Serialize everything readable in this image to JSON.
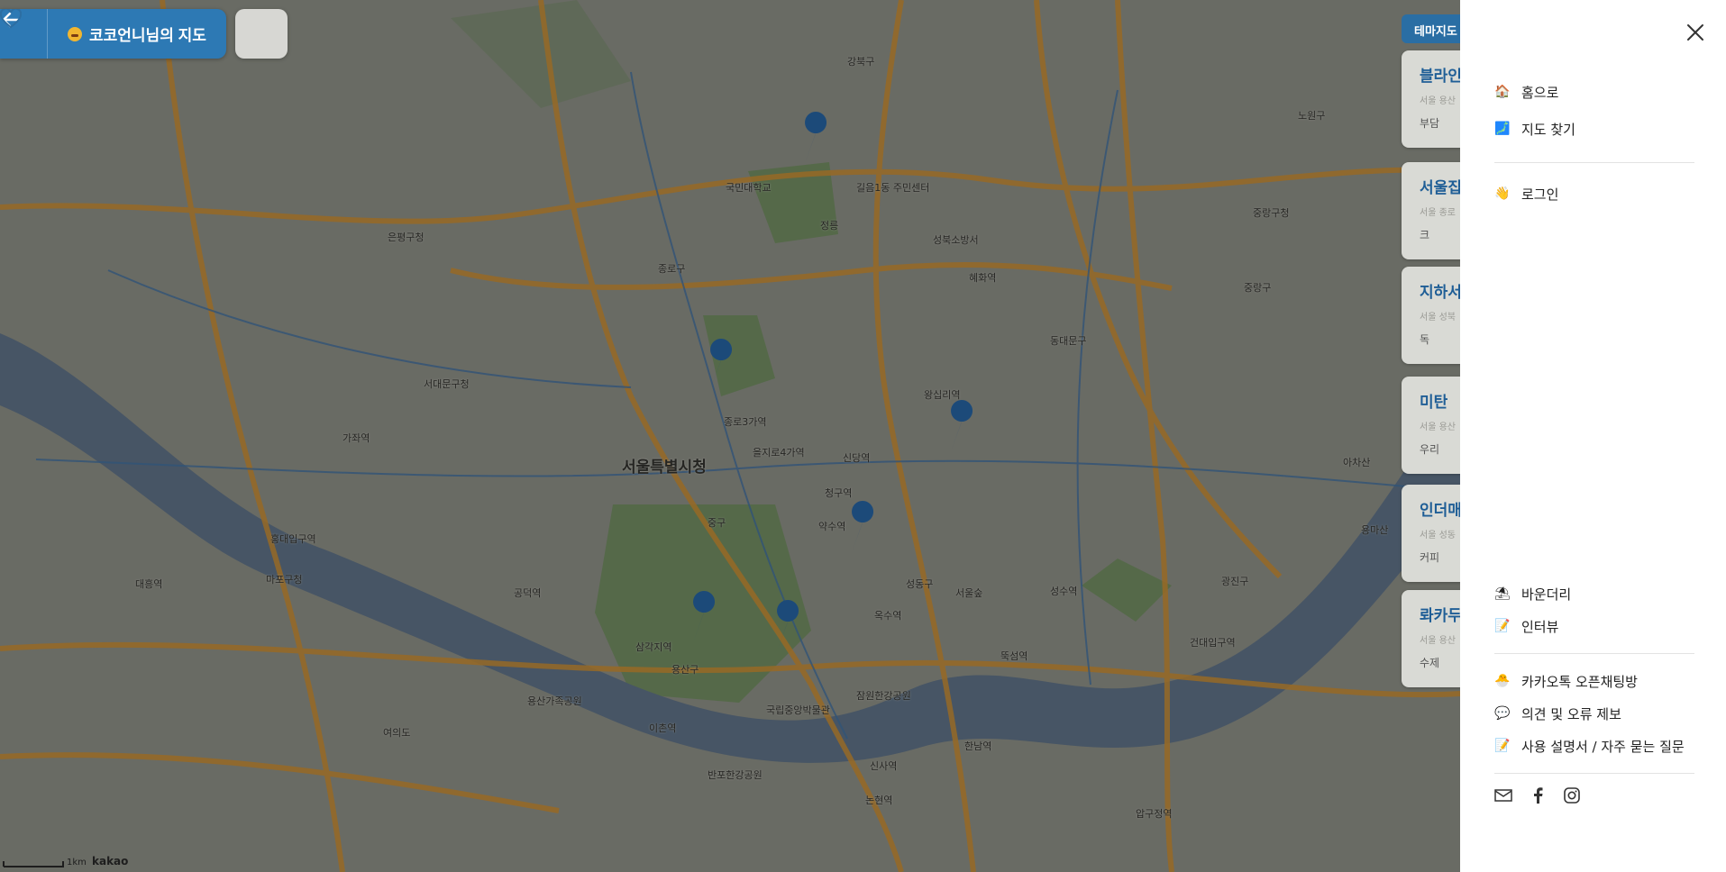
{
  "header": {
    "title": "코코언니님의 지도",
    "back_icon": "arrow-left-icon",
    "favorite_icon": "heart-icon"
  },
  "theme_tab": {
    "label": "테마지도"
  },
  "cards": [
    {
      "title": "블라인",
      "sub": "서울 용산",
      "cat": "부담"
    },
    {
      "title": "서울집",
      "sub": "서울 종로",
      "cat": "크"
    },
    {
      "title": "지하서",
      "sub": "서울 성북",
      "cat": "독"
    },
    {
      "title": "미탄",
      "sub": "서울 용산",
      "cat": "우리"
    },
    {
      "title": "인더매",
      "sub": "서울 성동",
      "cat": "커피"
    },
    {
      "title": "롸카두",
      "sub": "서울 용산",
      "cat": "수제"
    }
  ],
  "map_labels": [
    "서울특별시청",
    "국민대학교",
    "성북소방서",
    "정릉",
    "길음1동 주민센터",
    "중랑구청",
    "동대문구",
    "은평구청",
    "서대문구청",
    "종로구",
    "중구",
    "용산구",
    "성동구",
    "마포구청",
    "광진구",
    "중랑구",
    "대흥역",
    "가좌역",
    "홍대입구역",
    "공덕역",
    "삼각지역",
    "이촌역",
    "옥수역",
    "왕십리역",
    "신당역",
    "약수역",
    "혜화역",
    "노원구",
    "강북구",
    "종로3가역",
    "을지로4가역",
    "청구역",
    "건대입구역",
    "여의도",
    "한남역",
    "압구정역",
    "신사역",
    "논현역",
    "반포한강공원",
    "잠원한강공원",
    "서울숲",
    "뚝섬역",
    "성수역",
    "아차산",
    "용마산",
    "용산가족공원",
    "국립중앙박물관"
  ],
  "map_footer": {
    "scale": "1km",
    "brand": "kakao"
  },
  "drawer": {
    "close_icon": "close-icon",
    "nav": [
      {
        "icon": "home-icon",
        "label": "홈으로"
      },
      {
        "icon": "map-icon",
        "label": "지도 찾기"
      }
    ],
    "auth": [
      {
        "icon": "waving-hand-icon",
        "label": "로그인"
      }
    ],
    "info": [
      {
        "icon": "beach-umbrella-icon",
        "label": "바운더리"
      },
      {
        "icon": "memo-icon",
        "label": "인터뷰"
      }
    ],
    "support": [
      {
        "icon": "chick-icon",
        "label": "카카오톡 오픈채팅방"
      },
      {
        "icon": "speech-bubble-icon",
        "label": "의견 및 오류 제보"
      },
      {
        "icon": "memo-icon",
        "label": "사용 설명서 / 자주 묻는 질문"
      }
    ],
    "social": [
      "mail-icon",
      "facebook-icon",
      "instagram-icon"
    ]
  },
  "colors": {
    "primary": "#2d79b4",
    "drawer_bg": "#ffffff",
    "map_dim": "#7a7b72"
  }
}
